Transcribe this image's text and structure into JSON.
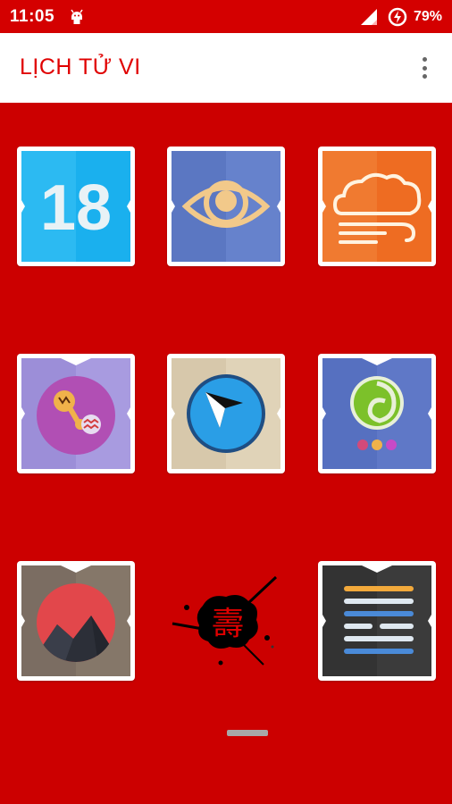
{
  "status_bar": {
    "time": "11:05",
    "battery_percent": "79%",
    "icons": [
      "android-icon",
      "signal-icon",
      "battery-saver-icon"
    ]
  },
  "app_bar": {
    "title": "LỊCH TỬ VI",
    "menu_icon": "more-vert-icon"
  },
  "grid": {
    "background_color": "#cc0000",
    "tiles": [
      {
        "name": "calendar",
        "icon": "calendar-icon",
        "text": "18",
        "color": "#1ab0ee"
      },
      {
        "name": "eye",
        "icon": "eye-icon",
        "color": "#5b77c2"
      },
      {
        "name": "weather",
        "icon": "cloud-wind-icon",
        "color": "#ee6c22"
      },
      {
        "name": "zodiac",
        "icon": "aquarius-zodiac-icon",
        "color": "#9c8ed8"
      },
      {
        "name": "compass",
        "icon": "compass-icon",
        "color": "#d7c8ab"
      },
      {
        "name": "feng-shui",
        "icon": "feng-shui-icon",
        "color": "#5f78c7"
      },
      {
        "name": "mountain",
        "icon": "mountain-sun-icon",
        "color": "#7b6d62"
      },
      {
        "name": "calligraphy",
        "icon": "ink-splash-icon",
        "glyph": "壽",
        "color": "#000000"
      },
      {
        "name": "notes",
        "icon": "text-lines-icon",
        "color": "#333333"
      }
    ]
  }
}
